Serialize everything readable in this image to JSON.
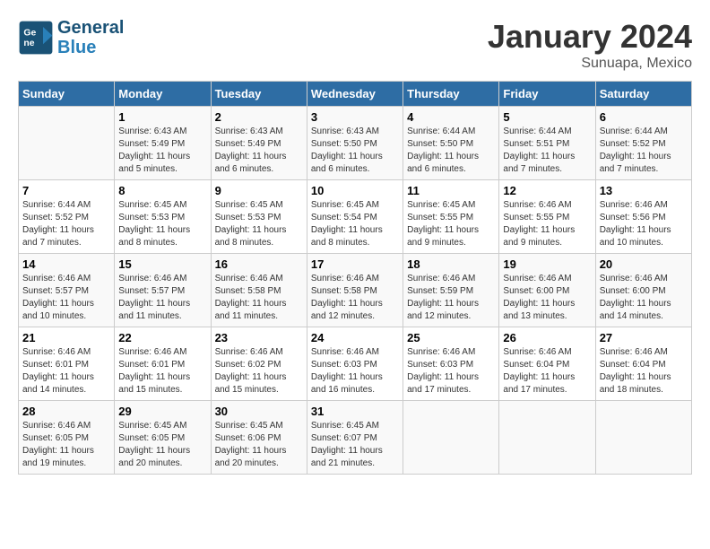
{
  "header": {
    "logo_line1": "General",
    "logo_line2": "Blue",
    "month": "January 2024",
    "location": "Sunuapa, Mexico"
  },
  "columns": [
    "Sunday",
    "Monday",
    "Tuesday",
    "Wednesday",
    "Thursday",
    "Friday",
    "Saturday"
  ],
  "weeks": [
    [
      {
        "day": "",
        "content": ""
      },
      {
        "day": "1",
        "content": "Sunrise: 6:43 AM\nSunset: 5:49 PM\nDaylight: 11 hours and 5 minutes."
      },
      {
        "day": "2",
        "content": "Sunrise: 6:43 AM\nSunset: 5:49 PM\nDaylight: 11 hours and 6 minutes."
      },
      {
        "day": "3",
        "content": "Sunrise: 6:43 AM\nSunset: 5:50 PM\nDaylight: 11 hours and 6 minutes."
      },
      {
        "day": "4",
        "content": "Sunrise: 6:44 AM\nSunset: 5:50 PM\nDaylight: 11 hours and 6 minutes."
      },
      {
        "day": "5",
        "content": "Sunrise: 6:44 AM\nSunset: 5:51 PM\nDaylight: 11 hours and 7 minutes."
      },
      {
        "day": "6",
        "content": "Sunrise: 6:44 AM\nSunset: 5:52 PM\nDaylight: 11 hours and 7 minutes."
      }
    ],
    [
      {
        "day": "7",
        "content": "Sunrise: 6:44 AM\nSunset: 5:52 PM\nDaylight: 11 hours and 7 minutes."
      },
      {
        "day": "8",
        "content": "Sunrise: 6:45 AM\nSunset: 5:53 PM\nDaylight: 11 hours and 8 minutes."
      },
      {
        "day": "9",
        "content": "Sunrise: 6:45 AM\nSunset: 5:53 PM\nDaylight: 11 hours and 8 minutes."
      },
      {
        "day": "10",
        "content": "Sunrise: 6:45 AM\nSunset: 5:54 PM\nDaylight: 11 hours and 8 minutes."
      },
      {
        "day": "11",
        "content": "Sunrise: 6:45 AM\nSunset: 5:55 PM\nDaylight: 11 hours and 9 minutes."
      },
      {
        "day": "12",
        "content": "Sunrise: 6:46 AM\nSunset: 5:55 PM\nDaylight: 11 hours and 9 minutes."
      },
      {
        "day": "13",
        "content": "Sunrise: 6:46 AM\nSunset: 5:56 PM\nDaylight: 11 hours and 10 minutes."
      }
    ],
    [
      {
        "day": "14",
        "content": "Sunrise: 6:46 AM\nSunset: 5:57 PM\nDaylight: 11 hours and 10 minutes."
      },
      {
        "day": "15",
        "content": "Sunrise: 6:46 AM\nSunset: 5:57 PM\nDaylight: 11 hours and 11 minutes."
      },
      {
        "day": "16",
        "content": "Sunrise: 6:46 AM\nSunset: 5:58 PM\nDaylight: 11 hours and 11 minutes."
      },
      {
        "day": "17",
        "content": "Sunrise: 6:46 AM\nSunset: 5:58 PM\nDaylight: 11 hours and 12 minutes."
      },
      {
        "day": "18",
        "content": "Sunrise: 6:46 AM\nSunset: 5:59 PM\nDaylight: 11 hours and 12 minutes."
      },
      {
        "day": "19",
        "content": "Sunrise: 6:46 AM\nSunset: 6:00 PM\nDaylight: 11 hours and 13 minutes."
      },
      {
        "day": "20",
        "content": "Sunrise: 6:46 AM\nSunset: 6:00 PM\nDaylight: 11 hours and 14 minutes."
      }
    ],
    [
      {
        "day": "21",
        "content": "Sunrise: 6:46 AM\nSunset: 6:01 PM\nDaylight: 11 hours and 14 minutes."
      },
      {
        "day": "22",
        "content": "Sunrise: 6:46 AM\nSunset: 6:01 PM\nDaylight: 11 hours and 15 minutes."
      },
      {
        "day": "23",
        "content": "Sunrise: 6:46 AM\nSunset: 6:02 PM\nDaylight: 11 hours and 15 minutes."
      },
      {
        "day": "24",
        "content": "Sunrise: 6:46 AM\nSunset: 6:03 PM\nDaylight: 11 hours and 16 minutes."
      },
      {
        "day": "25",
        "content": "Sunrise: 6:46 AM\nSunset: 6:03 PM\nDaylight: 11 hours and 17 minutes."
      },
      {
        "day": "26",
        "content": "Sunrise: 6:46 AM\nSunset: 6:04 PM\nDaylight: 11 hours and 17 minutes."
      },
      {
        "day": "27",
        "content": "Sunrise: 6:46 AM\nSunset: 6:04 PM\nDaylight: 11 hours and 18 minutes."
      }
    ],
    [
      {
        "day": "28",
        "content": "Sunrise: 6:46 AM\nSunset: 6:05 PM\nDaylight: 11 hours and 19 minutes."
      },
      {
        "day": "29",
        "content": "Sunrise: 6:45 AM\nSunset: 6:05 PM\nDaylight: 11 hours and 20 minutes."
      },
      {
        "day": "30",
        "content": "Sunrise: 6:45 AM\nSunset: 6:06 PM\nDaylight: 11 hours and 20 minutes."
      },
      {
        "day": "31",
        "content": "Sunrise: 6:45 AM\nSunset: 6:07 PM\nDaylight: 11 hours and 21 minutes."
      },
      {
        "day": "",
        "content": ""
      },
      {
        "day": "",
        "content": ""
      },
      {
        "day": "",
        "content": ""
      }
    ]
  ]
}
